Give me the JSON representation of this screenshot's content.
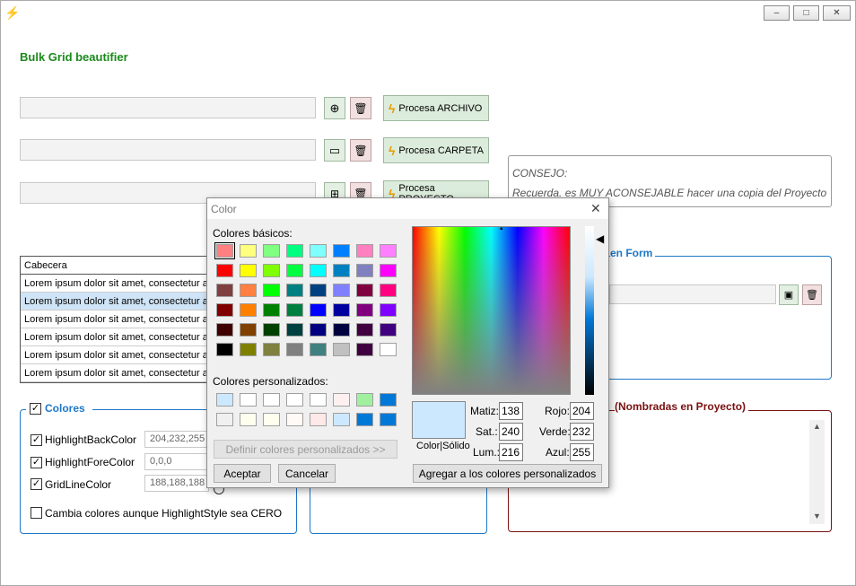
{
  "window": {
    "minimize": "–",
    "maximize": "□",
    "close": "✕"
  },
  "app_title": "Bulk Grid beautifier",
  "buttons": {
    "procesa_archivo": "Procesa ARCHIVO",
    "procesa_carpeta": "Procesa CARPETA",
    "procesa_proyecto": "Procesa PROYECTO"
  },
  "consejo": {
    "title": "CONSEJO:",
    "text": "Recuerda. es MUY ACONSEJABLE hacer una copia del Proyecto"
  },
  "grid": {
    "header": "Cabecera",
    "rows": [
      "Lorem ipsum dolor sit amet, consectetur adipiscing",
      "Lorem ipsum dolor sit amet, consectetur adipiscing",
      "Lorem ipsum dolor sit amet, consectetur adipiscing",
      "Lorem ipsum dolor sit amet, consectetur adipiscing",
      "Lorem ipsum dolor sit amet, consectetur adipiscing",
      "Lorem ipsum dolor sit amet, consectetur adipiscing"
    ]
  },
  "colores": {
    "title": "Colores",
    "items": [
      {
        "label": "HighlightBackColor",
        "value": "204,232,255",
        "checked": true
      },
      {
        "label": "HighlightForeColor",
        "value": "0,0,0",
        "checked": true
      },
      {
        "label": "GridLineColor",
        "value": "188,188,188",
        "checked": true
      }
    ],
    "cambia": "Cambia colores aunque HighlightStyle sea CERO"
  },
  "form_group": {
    "title_partial": "en Form"
  },
  "proyecto_group": {
    "title_partial": "(Nombradas en Proyecto)"
  },
  "dialog": {
    "title": "Color",
    "basic_label": "Colores básicos:",
    "custom_label": "Colores personalizados:",
    "define_btn": "Definir colores personalizados >>",
    "accept": "Aceptar",
    "cancel": "Cancelar",
    "color_solid": "Color|Sólido",
    "matiz_label": "Matiz:",
    "matiz": "138",
    "sat_label": "Sat.:",
    "sat": "240",
    "lum_label": "Lum.:",
    "lum": "216",
    "rojo_label": "Rojo:",
    "rojo": "204",
    "verde_label": "Verde:",
    "verde": "232",
    "azul_label": "Azul:",
    "azul": "255",
    "add_btn": "Agregar a los colores personalizados",
    "preview_color": "#cce8ff",
    "basic_colors": [
      "#ff8080",
      "#ffff80",
      "#80ff80",
      "#00ff80",
      "#80ffff",
      "#0080ff",
      "#ff80c0",
      "#ff80ff",
      "#ff0000",
      "#ffff00",
      "#80ff00",
      "#00ff40",
      "#00ffff",
      "#0080c0",
      "#8080c0",
      "#ff00ff",
      "#804040",
      "#ff8040",
      "#00ff00",
      "#008080",
      "#004080",
      "#8080ff",
      "#800040",
      "#ff0080",
      "#800000",
      "#ff8000",
      "#008000",
      "#008040",
      "#0000ff",
      "#0000a0",
      "#800080",
      "#8000ff",
      "#400000",
      "#804000",
      "#004000",
      "#004040",
      "#000080",
      "#000040",
      "#400040",
      "#400080",
      "#000000",
      "#808000",
      "#808040",
      "#808080",
      "#408080",
      "#c0c0c0",
      "#400040",
      "#ffffff"
    ],
    "custom_colors": [
      "#cce8ff",
      "#ffffff",
      "#ffffff",
      "#ffffff",
      "#ffffff",
      "#fff0f0",
      "#a0f0a0",
      "#0078d7",
      "#f0f0f0",
      "#fffff0",
      "#fffff0",
      "#fffaf5",
      "#ffe8e8",
      "#cce8ff",
      "#0078d7",
      "#0078d7"
    ]
  }
}
